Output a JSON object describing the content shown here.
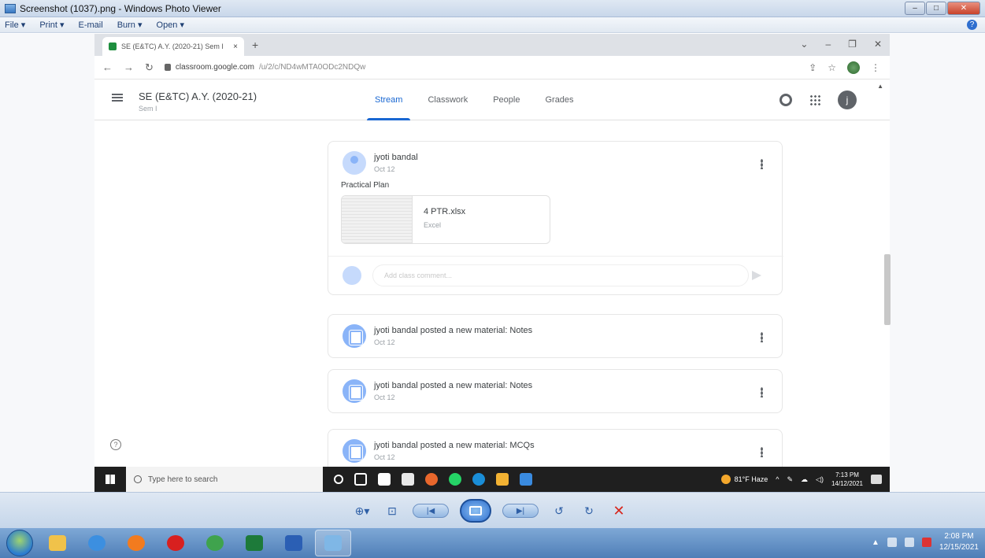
{
  "photo_viewer": {
    "title": "Screenshot (1037).png - Windows Photo Viewer",
    "menu": [
      "File ▾",
      "Print ▾",
      "E-mail",
      "Burn ▾",
      "Open ▾"
    ],
    "help": "?"
  },
  "browser": {
    "tab_title": "SE (E&TC) A.Y. (2020-21) Sem I",
    "tab_close": "×",
    "new_tab": "+",
    "url_host": "classroom.google.com",
    "url_path": "/u/2/c/ND4wMTA0ODc2NDQw"
  },
  "classroom": {
    "class_title": "SE (E&TC) A.Y. (2020-21)",
    "class_subtitle": "Sem I",
    "tabs": [
      "Stream",
      "Classwork",
      "People",
      "Grades"
    ],
    "active_tab": "Stream",
    "account_initial": "j"
  },
  "stream": {
    "post": {
      "author": "jyoti bandal",
      "date": "Oct 12",
      "text": "Practical Plan",
      "attachment_name": "4 PTR.xlsx",
      "attachment_type": "Excel",
      "comment_placeholder": "Add class comment..."
    },
    "materials": [
      {
        "title": "jyoti bandal posted a new material: Notes",
        "date": "Oct 12"
      },
      {
        "title": "jyoti bandal posted a new material: Notes",
        "date": "Oct 12"
      },
      {
        "title": "jyoti bandal posted a new material: MCQs",
        "date": "Oct 12"
      }
    ]
  },
  "win10_taskbar": {
    "search_placeholder": "Type here to search",
    "weather": "81°F Haze",
    "time": "7:13 PM",
    "date": "14/12/2021"
  },
  "win7_taskbar": {
    "time": "2:08 PM",
    "date": "12/15/2021"
  },
  "colors": {
    "accent": "#1967d2",
    "win7_taskbar": "#4f7eb7"
  }
}
